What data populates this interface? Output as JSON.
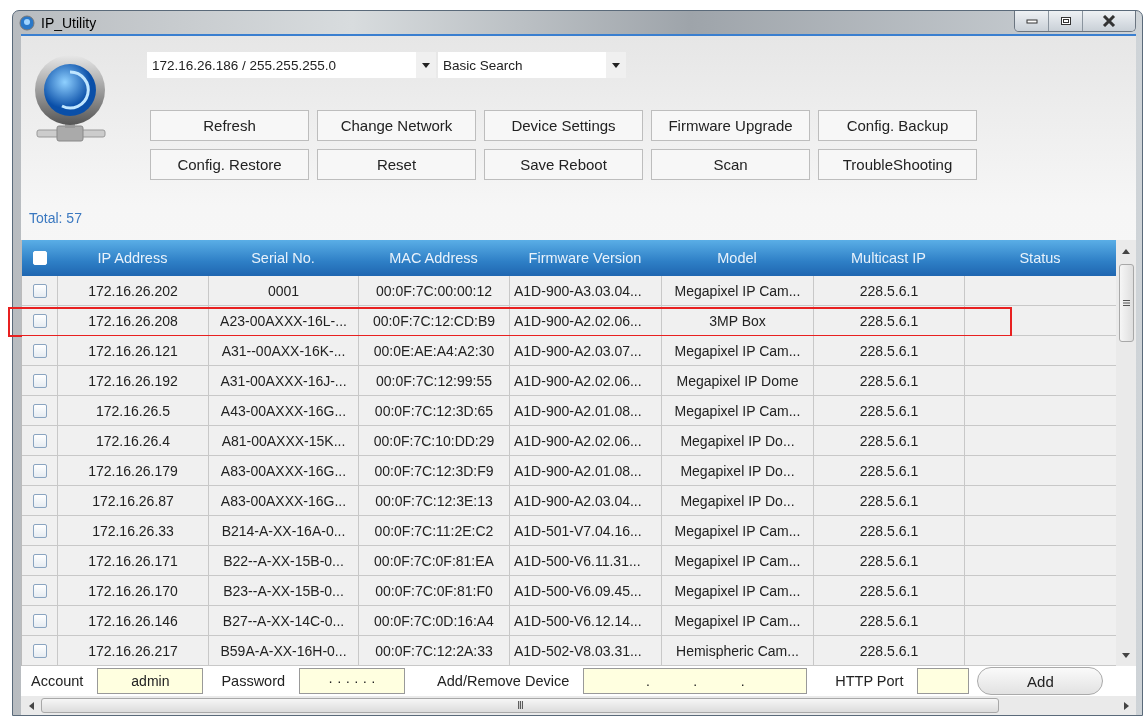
{
  "window": {
    "title": "IP_Utility"
  },
  "network_select": {
    "value": "172.16.26.186 / 255.255.255.0"
  },
  "search_mode": {
    "value": "Basic Search"
  },
  "buttons": [
    {
      "label": "Refresh"
    },
    {
      "label": "Change Network"
    },
    {
      "label": "Device Settings"
    },
    {
      "label": "Firmware Upgrade"
    },
    {
      "label": "Config. Backup"
    },
    {
      "label": "Config. Restore"
    },
    {
      "label": "Reset"
    },
    {
      "label": "Save Reboot"
    },
    {
      "label": "Scan"
    },
    {
      "label": "TroubleShooting"
    }
  ],
  "total": "Total: 57",
  "table": {
    "select_all_checked": false,
    "columns": [
      "IP Address",
      "Serial No.",
      "MAC Address",
      "Firmware Version",
      "Model",
      "Multicast IP",
      "Status"
    ],
    "rows": [
      {
        "checked": false,
        "highlighted": false,
        "cells": [
          "172.16.26.202",
          "0001",
          "00:0F:7C:00:00:12",
          "A1D-900-A3.03.04...",
          "Megapixel IP Cam...",
          "228.5.6.1"
        ]
      },
      {
        "checked": false,
        "highlighted": true,
        "cells": [
          "172.16.26.208",
          "A23-00AXXX-16L-...",
          "00:0F:7C:12:CD:B9",
          "A1D-900-A2.02.06...",
          "3MP Box",
          "228.5.6.1"
        ]
      },
      {
        "checked": false,
        "highlighted": false,
        "cells": [
          "172.16.26.121",
          "A31--00AXX-16K-...",
          "00:0E:AE:A4:A2:30",
          "A1D-900-A2.03.07...",
          "Megapixel IP Cam...",
          "228.5.6.1"
        ]
      },
      {
        "checked": false,
        "highlighted": false,
        "cells": [
          "172.16.26.192",
          "A31-00AXXX-16J-...",
          "00:0F:7C:12:99:55",
          "A1D-900-A2.02.06...",
          "Megapixel IP Dome",
          "228.5.6.1"
        ]
      },
      {
        "checked": false,
        "highlighted": false,
        "cells": [
          "172.16.26.5",
          "A43-00AXXX-16G...",
          "00:0F:7C:12:3D:65",
          "A1D-900-A2.01.08...",
          "Megapixel IP Cam...",
          "228.5.6.1"
        ]
      },
      {
        "checked": false,
        "highlighted": false,
        "cells": [
          "172.16.26.4",
          "A81-00AXXX-15K...",
          "00:0F:7C:10:DD:29",
          "A1D-900-A2.02.06...",
          "Megapixel IP Do...",
          "228.5.6.1"
        ]
      },
      {
        "checked": false,
        "highlighted": false,
        "cells": [
          "172.16.26.179",
          "A83-00AXXX-16G...",
          "00:0F:7C:12:3D:F9",
          "A1D-900-A2.01.08...",
          "Megapixel IP Do...",
          "228.5.6.1"
        ]
      },
      {
        "checked": false,
        "highlighted": false,
        "cells": [
          "172.16.26.87",
          "A83-00AXXX-16G...",
          "00:0F:7C:12:3E:13",
          "A1D-900-A2.03.04...",
          "Megapixel IP Do...",
          "228.5.6.1"
        ]
      },
      {
        "checked": false,
        "highlighted": false,
        "cells": [
          "172.16.26.33",
          "B214-A-XX-16A-0...",
          "00:0F:7C:11:2E:C2",
          "A1D-501-V7.04.16...",
          "Megapixel IP Cam...",
          "228.5.6.1"
        ]
      },
      {
        "checked": false,
        "highlighted": false,
        "cells": [
          "172.16.26.171",
          "B22--A-XX-15B-0...",
          "00:0F:7C:0F:81:EA",
          "A1D-500-V6.11.31...",
          "Megapixel IP Cam...",
          "228.5.6.1"
        ]
      },
      {
        "checked": false,
        "highlighted": false,
        "cells": [
          "172.16.26.170",
          "B23--A-XX-15B-0...",
          "00:0F:7C:0F:81:F0",
          "A1D-500-V6.09.45...",
          "Megapixel IP Cam...",
          "228.5.6.1"
        ]
      },
      {
        "checked": false,
        "highlighted": false,
        "cells": [
          "172.16.26.146",
          "B27--A-XX-14C-0...",
          "00:0F:7C:0D:16:A4",
          "A1D-500-V6.12.14...",
          "Megapixel IP Cam...",
          "228.5.6.1"
        ]
      },
      {
        "checked": false,
        "highlighted": false,
        "cells": [
          "172.16.26.217",
          "B59A-A-XX-16H-0...",
          "00:0F:7C:12:2A:33",
          "A1D-502-V8.03.31...",
          "Hemispheric Cam...",
          "228.5.6.1"
        ]
      }
    ]
  },
  "footer": {
    "account_label": "Account",
    "account": "admin",
    "password_label": "Password",
    "password": "· · · · · ·",
    "device_label": "Add/Remove Device",
    "device_dots": [
      ".",
      ".",
      "."
    ],
    "port_label": "HTTP Port",
    "add_button": "Add"
  },
  "scrollbar_grip": "III"
}
